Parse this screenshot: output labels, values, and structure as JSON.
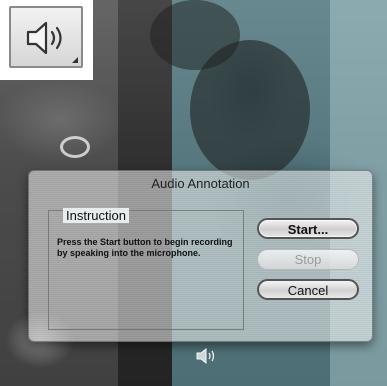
{
  "dialog": {
    "title": "Audio Annotation",
    "group_label": "Instruction",
    "instruction_text": "Press the Start button to begin recording by speaking into the microphone.",
    "buttons": {
      "start": "Start...",
      "stop": "Stop",
      "cancel": "Cancel"
    },
    "stop_enabled": false
  },
  "icons": {
    "top_left": "speaker-icon",
    "bottom_small": "speaker-icon"
  },
  "colors": {
    "panel_tint": "#78c8d7",
    "button_border": "#555555",
    "disabled_text": "#9a9a9a"
  }
}
